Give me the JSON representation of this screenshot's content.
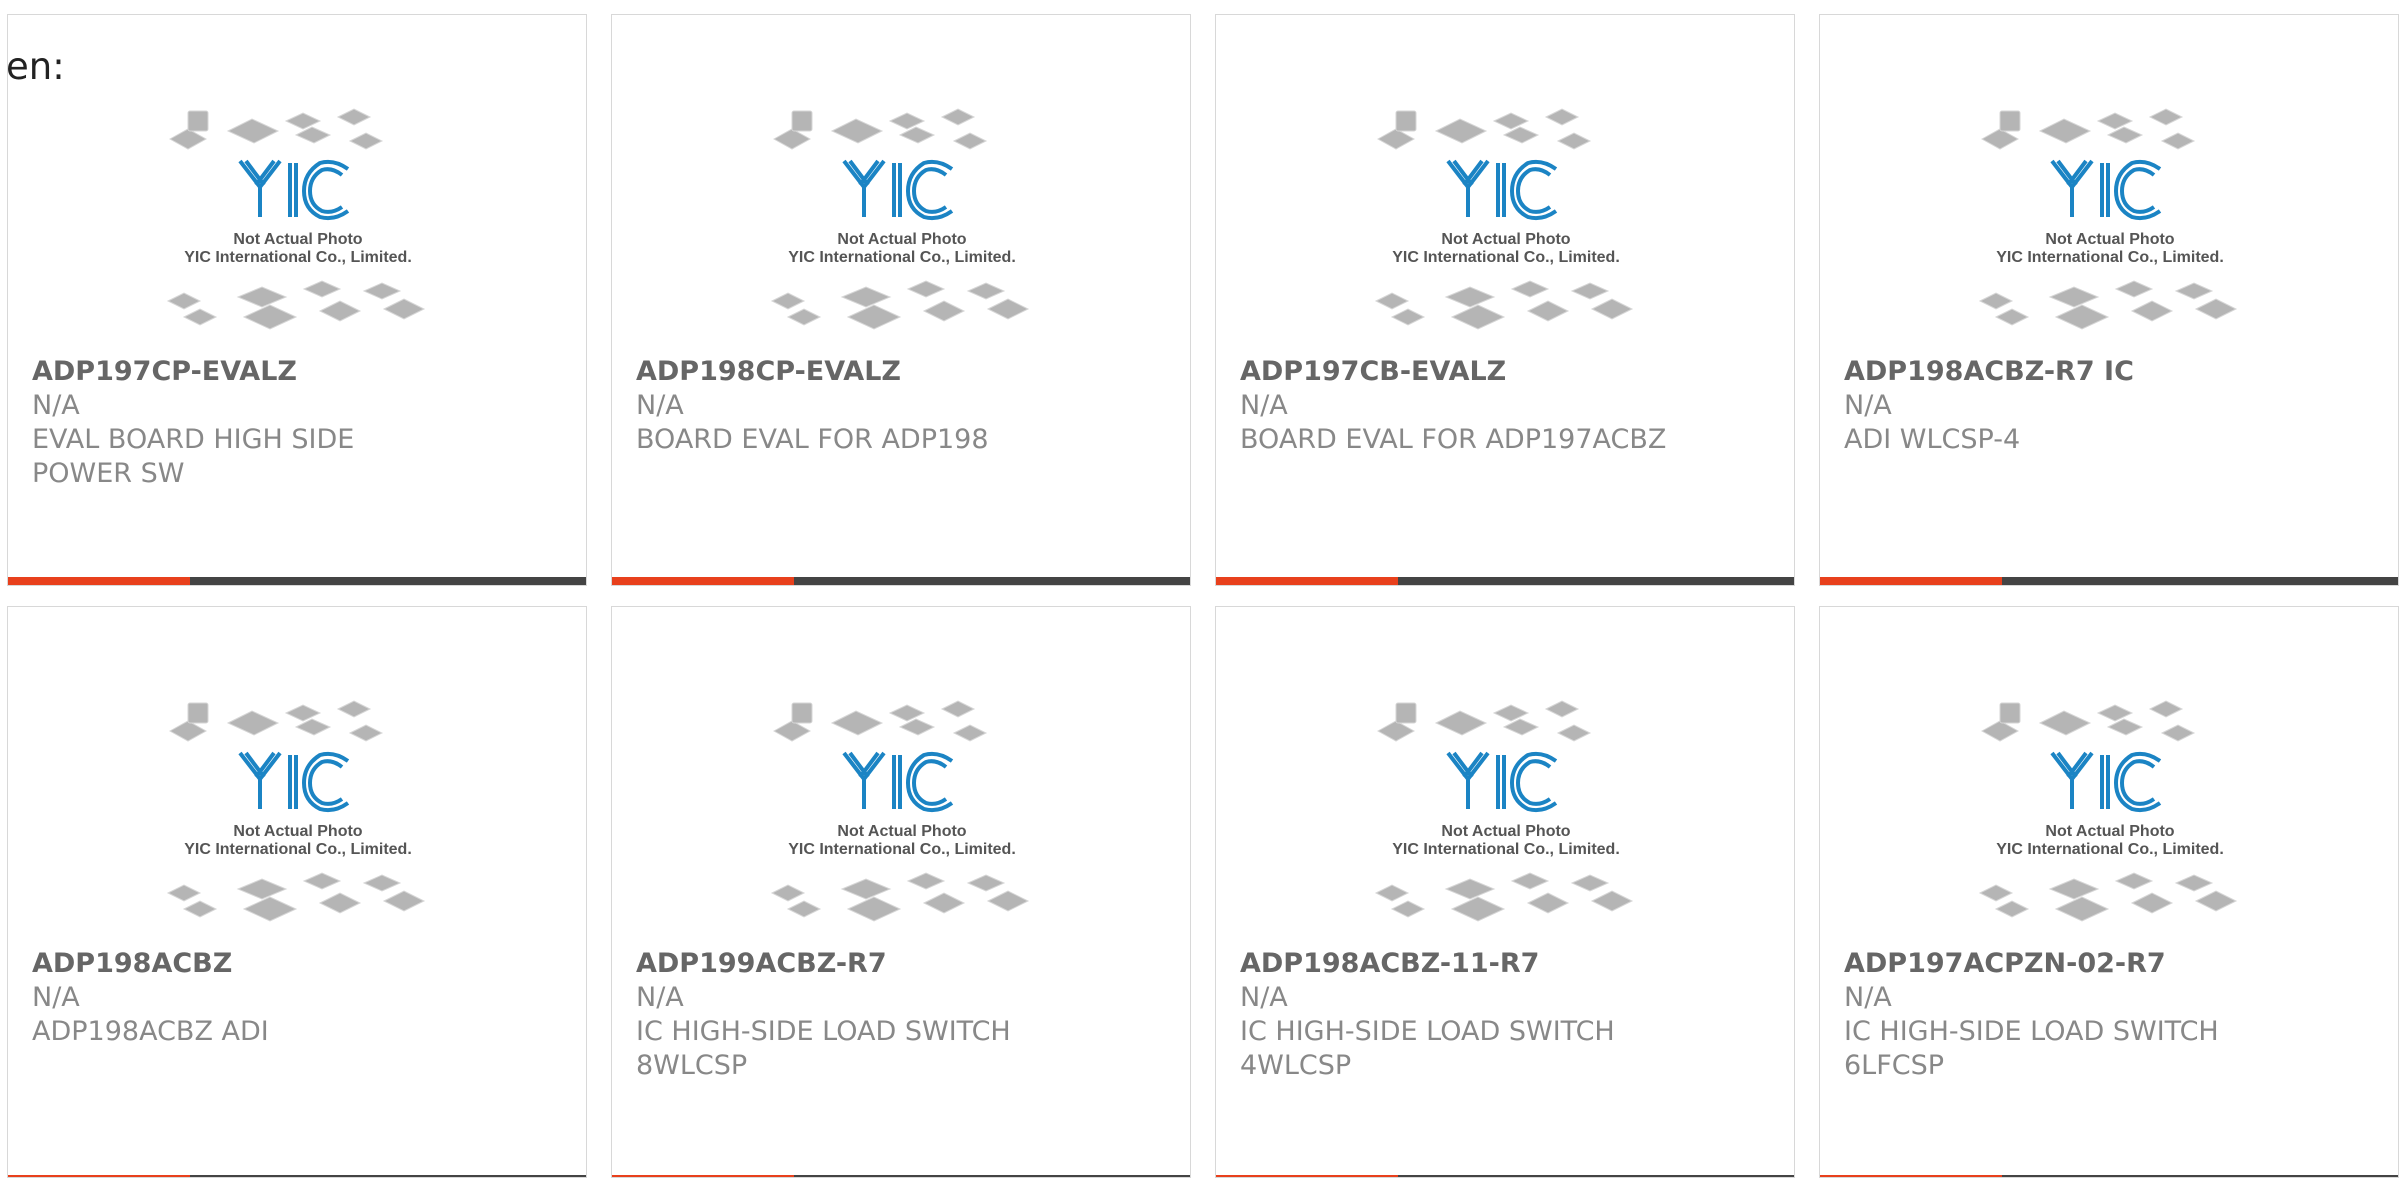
{
  "lang_label": "en:",
  "accent_color": "#e8401c",
  "bar_color": "#444444",
  "placeholder": {
    "line1": "Not Actual Photo",
    "line2": "YIC International Co., Limited.",
    "logo_text": "YIC"
  },
  "products": [
    {
      "part": "ADP197CP-EVALZ",
      "mfr": "N/A",
      "desc": "EVAL BOARD HIGH SIDE POWER SW"
    },
    {
      "part": "ADP198CP-EVALZ",
      "mfr": "N/A",
      "desc": "BOARD EVAL FOR ADP198"
    },
    {
      "part": "ADP197CB-EVALZ",
      "mfr": "N/A",
      "desc": "BOARD EVAL FOR ADP197ACBZ"
    },
    {
      "part": "ADP198ACBZ-R7 IC",
      "mfr": "N/A",
      "desc": "ADI WLCSP-4"
    },
    {
      "part": "ADP198ACBZ",
      "mfr": "N/A",
      "desc": "ADP198ACBZ ADI"
    },
    {
      "part": "ADP199ACBZ-R7",
      "mfr": "N/A",
      "desc": "IC HIGH-SIDE LOAD SWITCH 8WLCSP"
    },
    {
      "part": "ADP198ACBZ-11-R7",
      "mfr": "N/A",
      "desc": "IC HIGH-SIDE LOAD SWITCH 4WLCSP"
    },
    {
      "part": "ADP197ACPZN-02-R7",
      "mfr": "N/A",
      "desc": "IC HIGH-SIDE LOAD SWITCH 6LFCSP"
    }
  ]
}
